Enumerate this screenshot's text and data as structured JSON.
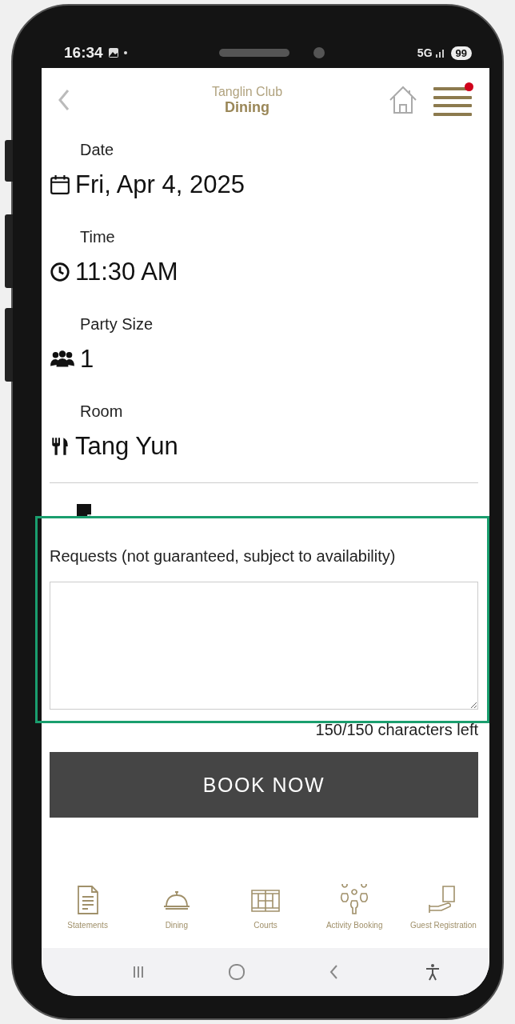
{
  "status_bar": {
    "time": "16:34",
    "network": "5G",
    "battery": "99"
  },
  "header": {
    "title": "Tanglin Club",
    "subtitle": "Dining",
    "notification": true
  },
  "fields": [
    {
      "kind": "date",
      "label": "Date",
      "value": "Fri, Apr 4, 2025"
    },
    {
      "kind": "time",
      "label": "Time",
      "value": "11:30 AM"
    },
    {
      "kind": "party",
      "label": "Party Size",
      "value": "1"
    },
    {
      "kind": "room",
      "label": "Room",
      "value": "Tang Yun"
    }
  ],
  "requests": {
    "label": "Requests (not guaranteed, subject to availability)",
    "counter": "150/150 characters left"
  },
  "book_button": "BOOK NOW",
  "tabs": [
    {
      "kind": "statements",
      "label": "Statements"
    },
    {
      "kind": "dining",
      "label": "Dining"
    },
    {
      "kind": "courts",
      "label": "Courts"
    },
    {
      "kind": "activity",
      "label": "Activity Booking"
    },
    {
      "kind": "guest",
      "label": "Guest Registration"
    }
  ]
}
